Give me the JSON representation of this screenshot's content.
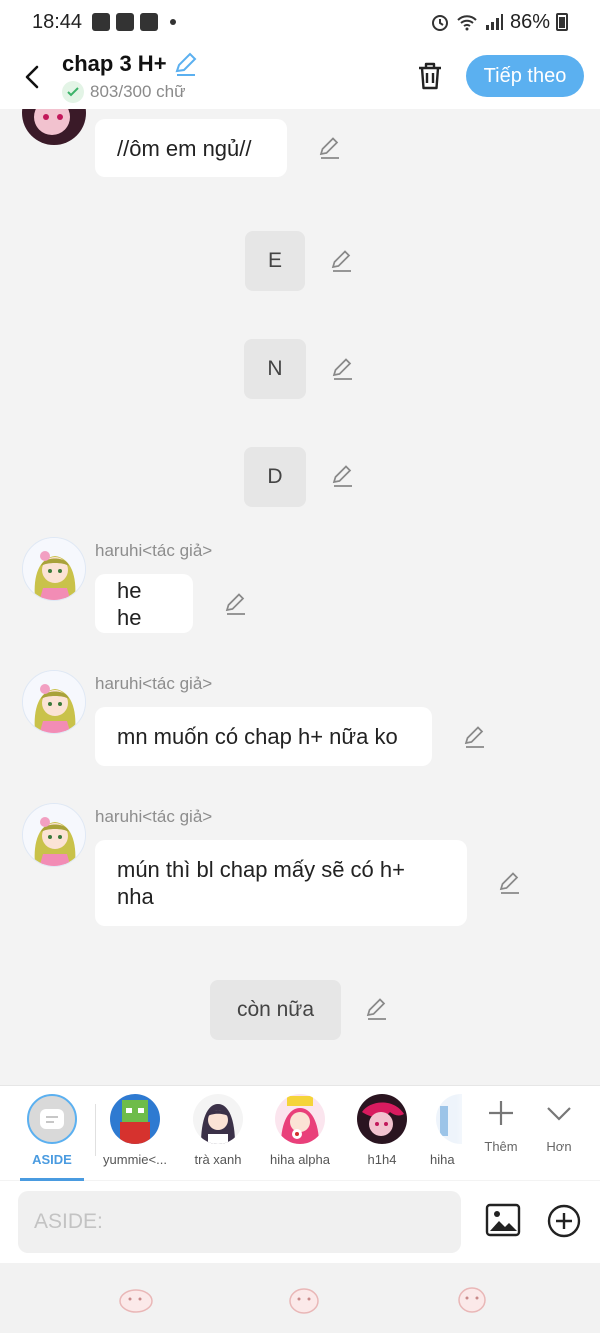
{
  "status_bar": {
    "time": "18:44",
    "battery": "86%"
  },
  "header": {
    "title": "chap 3 H+",
    "word_count": "803/300 chữ",
    "next_label": "Tiếp theo"
  },
  "messages": {
    "m1": "//ôm em ngủ//",
    "c1": "E",
    "c2": "N",
    "c3": "D",
    "m2_author": "haruhi<tác giả>",
    "m2": "he he",
    "m3_author": "haruhi<tác giả>",
    "m3": "mn muốn có chap h+ nữa ko",
    "m4_author": "haruhi<tác giả>",
    "m4": "mún thì bl chap mấy sẽ có h+ nha",
    "c4": "còn nữa"
  },
  "characters": [
    {
      "name": "ASIDE"
    },
    {
      "name": "yummie<..."
    },
    {
      "name": "trà xanh"
    },
    {
      "name": "hiha alpha"
    },
    {
      "name": "h1h4"
    },
    {
      "name": "hiha"
    }
  ],
  "tools": {
    "add_label": "Thêm",
    "more_label": "Hơn"
  },
  "input": {
    "placeholder": "ASIDE:"
  },
  "colors": {
    "accent": "#5bb0f0",
    "background": "#f3f3f3",
    "bubble": "#ffffff"
  }
}
